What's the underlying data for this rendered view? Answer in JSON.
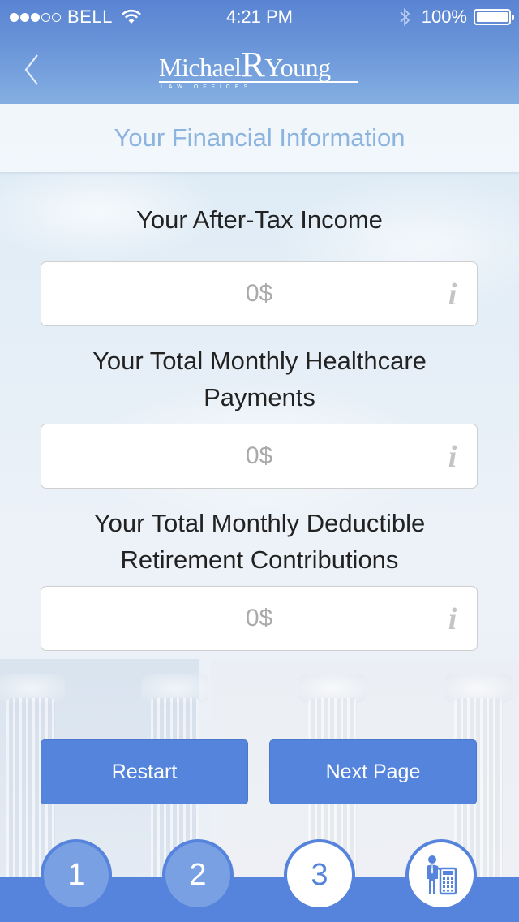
{
  "status_bar": {
    "signal_filled": 3,
    "signal_total": 5,
    "carrier": "BELL",
    "time": "4:21 PM",
    "battery_percent": "100%",
    "battery_level": 1.0
  },
  "nav": {
    "back_icon": "chevron-left-icon",
    "logo": {
      "first": "Michael",
      "initial": "R",
      "last": "Young",
      "subtitle": "LAW OFFICES"
    }
  },
  "page": {
    "title": "Your Financial Information"
  },
  "form": {
    "fields": [
      {
        "label": "Your After-Tax Income",
        "value": "",
        "placeholder": "0$",
        "info_icon": "info-icon"
      },
      {
        "label": "Your Total Monthly Healthcare Payments",
        "value": "",
        "placeholder": "0$",
        "info_icon": "info-icon"
      },
      {
        "label": "Your Total Monthly Deductible Retirement Contributions",
        "value": "",
        "placeholder": "0$",
        "info_icon": "info-icon"
      }
    ]
  },
  "buttons": {
    "restart": "Restart",
    "next": "Next Page"
  },
  "steps": [
    {
      "label": "1",
      "state": "done"
    },
    {
      "label": "2",
      "state": "done"
    },
    {
      "label": "3",
      "state": "current"
    },
    {
      "label": "",
      "icon": "person-calculator-icon",
      "state": "upcoming"
    }
  ],
  "colors": {
    "accent": "#5684dc",
    "title": "#8cb4de",
    "header_top": "#5a84d2"
  }
}
